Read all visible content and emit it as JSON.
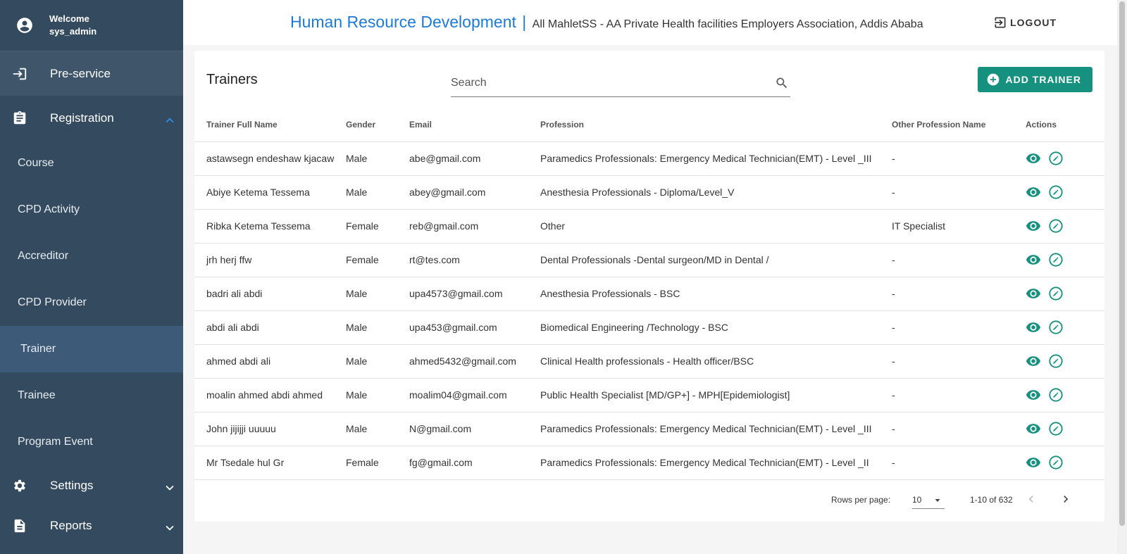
{
  "user": {
    "welcome": "Welcome",
    "name": "sys_admin"
  },
  "nav": {
    "preservice": "Pre-service",
    "registration": "Registration",
    "sub": [
      "Course",
      "CPD Activity",
      "Accreditor",
      "CPD Provider",
      "Trainer",
      "Trainee",
      "Program Event"
    ],
    "settings": "Settings",
    "reports": "Reports"
  },
  "header": {
    "title": "Human Resource Development",
    "separator": "|",
    "org": "All MahletSS - AA Private Health facilities Employers Association, Addis Ababa",
    "logout": "LOGOUT"
  },
  "page": {
    "title": "Trainers",
    "search_placeholder": "Search",
    "add_button": "ADD TRAINER"
  },
  "table": {
    "headers": [
      "Trainer Full Name",
      "Gender",
      "Email",
      "Profession",
      "Other Profession Name",
      "Actions"
    ],
    "rows": [
      [
        "astawsegn endeshaw kjacaw",
        "Male",
        "abe@gmail.com",
        "Paramedics Professionals: Emergency Medical Technician(EMT) - Level _III",
        "-"
      ],
      [
        "Abiye Ketema Tessema",
        "Male",
        "abey@gmail.com",
        "Anesthesia Professionals - Diploma/Level_V",
        "-"
      ],
      [
        "Ribka Ketema Tessema",
        "Female",
        "reb@gmail.com",
        "Other",
        "IT Specialist"
      ],
      [
        "jrh herj ffw",
        "Female",
        "rt@tes.com",
        "Dental Professionals -Dental surgeon/MD in Dental /",
        "-"
      ],
      [
        "badri ali abdi",
        "Male",
        "upa4573@gmail.com",
        "Anesthesia Professionals - BSC",
        "-"
      ],
      [
        "abdi ali abdi",
        "Male",
        "upa453@gmail.com",
        "Biomedical Engineering /Technology - BSC",
        "-"
      ],
      [
        "ahmed abdi ali",
        "Male",
        "ahmed5432@gmail.com",
        "Clinical Health professionals - Health officer/BSC",
        "-"
      ],
      [
        "moalin ahmed abdi ahmed",
        "Male",
        "moalim04@gmail.com",
        "Public Health Specialist [MD/GP+] - MPH[Epidemiologist]",
        "-"
      ],
      [
        "John jijijji uuuuu",
        "Male",
        "N@gmail.com",
        "Paramedics Professionals: Emergency Medical Technician(EMT) - Level _III",
        "-"
      ],
      [
        "Mr Tsedale hul Gr",
        "Female",
        "fg@gmail.com",
        "Paramedics Professionals: Emergency Medical Technician(EMT) - Level _II",
        "-"
      ]
    ]
  },
  "pagination": {
    "rows_label": "Rows per page:",
    "rows_value": "10",
    "range": "1-10 of 632"
  },
  "colors": {
    "sidebar": "#344a5e",
    "accent": "#16917f",
    "title": "#1e7ad6"
  },
  "icons": [
    "account-circle-icon",
    "login-icon",
    "clipboard-icon",
    "chevron-up-icon",
    "gear-icon",
    "chevron-down-icon",
    "document-icon",
    "logout-icon",
    "search-icon",
    "add-circle-icon",
    "eye-icon",
    "edit-icon",
    "chevron-left-icon",
    "chevron-right-icon"
  ]
}
